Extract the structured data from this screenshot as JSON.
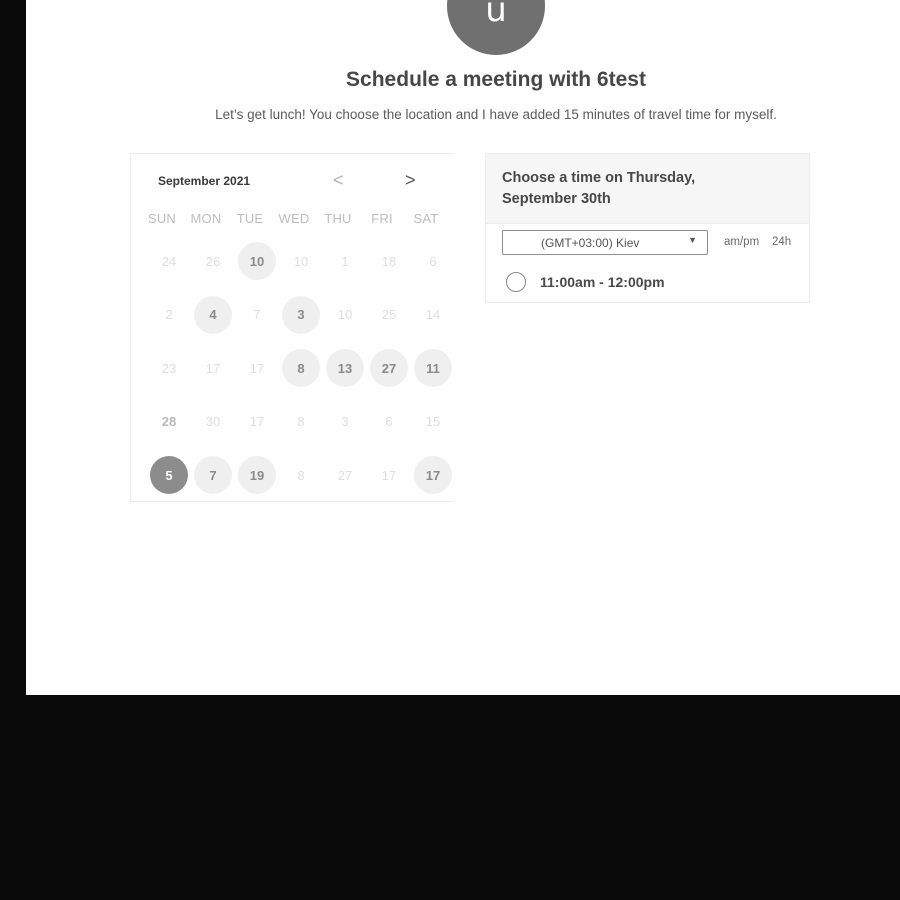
{
  "host": {
    "avatar_letter": "u",
    "title": "Schedule a meeting with 6test",
    "description": "Let’s get lunch! You choose the location and I have added 15 minutes of travel time for myself."
  },
  "calendar": {
    "month_label": "September 2021",
    "prev_icon": "chevron-left-icon",
    "next_icon": "chevron-right-icon",
    "prev_glyph": "<",
    "next_glyph": ">",
    "weekdays": [
      "SUN",
      "MON",
      "TUE",
      "WED",
      "THU",
      "FRI",
      "SAT"
    ],
    "weeks": [
      [
        {
          "d": "24",
          "s": "off"
        },
        {
          "d": "26",
          "s": "off"
        },
        {
          "d": "10",
          "s": "avail"
        },
        {
          "d": "10",
          "s": "off"
        },
        {
          "d": "1",
          "s": "off"
        },
        {
          "d": "18",
          "s": "off"
        },
        {
          "d": "6",
          "s": "off"
        }
      ],
      [
        {
          "d": "2",
          "s": "off"
        },
        {
          "d": "4",
          "s": "avail"
        },
        {
          "d": "7",
          "s": "off"
        },
        {
          "d": "3",
          "s": "avail"
        },
        {
          "d": "10",
          "s": "off"
        },
        {
          "d": "25",
          "s": "off"
        },
        {
          "d": "14",
          "s": "off"
        }
      ],
      [
        {
          "d": "23",
          "s": "off"
        },
        {
          "d": "17",
          "s": "off"
        },
        {
          "d": "17",
          "s": "off"
        },
        {
          "d": "8",
          "s": "avail"
        },
        {
          "d": "13",
          "s": "avail"
        },
        {
          "d": "27",
          "s": "avail"
        },
        {
          "d": "11",
          "s": "avail"
        }
      ],
      [
        {
          "d": "28",
          "s": "dim-bold"
        },
        {
          "d": "30",
          "s": "off"
        },
        {
          "d": "17",
          "s": "off"
        },
        {
          "d": "8",
          "s": "off"
        },
        {
          "d": "3",
          "s": "off"
        },
        {
          "d": "6",
          "s": "off"
        },
        {
          "d": "15",
          "s": "off"
        }
      ],
      [
        {
          "d": "5",
          "s": "selected"
        },
        {
          "d": "7",
          "s": "avail"
        },
        {
          "d": "19",
          "s": "avail"
        },
        {
          "d": "8",
          "s": "off"
        },
        {
          "d": "27",
          "s": "off"
        },
        {
          "d": "17",
          "s": "off"
        },
        {
          "d": "17",
          "s": "avail"
        }
      ]
    ]
  },
  "times": {
    "heading": "Choose a time on Thursday, September 30th",
    "timezone": "(GMT+03:00) Kiev",
    "timezone_caret_icon": "caret-down-icon",
    "format_ampm": "am/pm",
    "format_24h": "24h",
    "slots": [
      "11:00am - 12:00pm"
    ]
  }
}
